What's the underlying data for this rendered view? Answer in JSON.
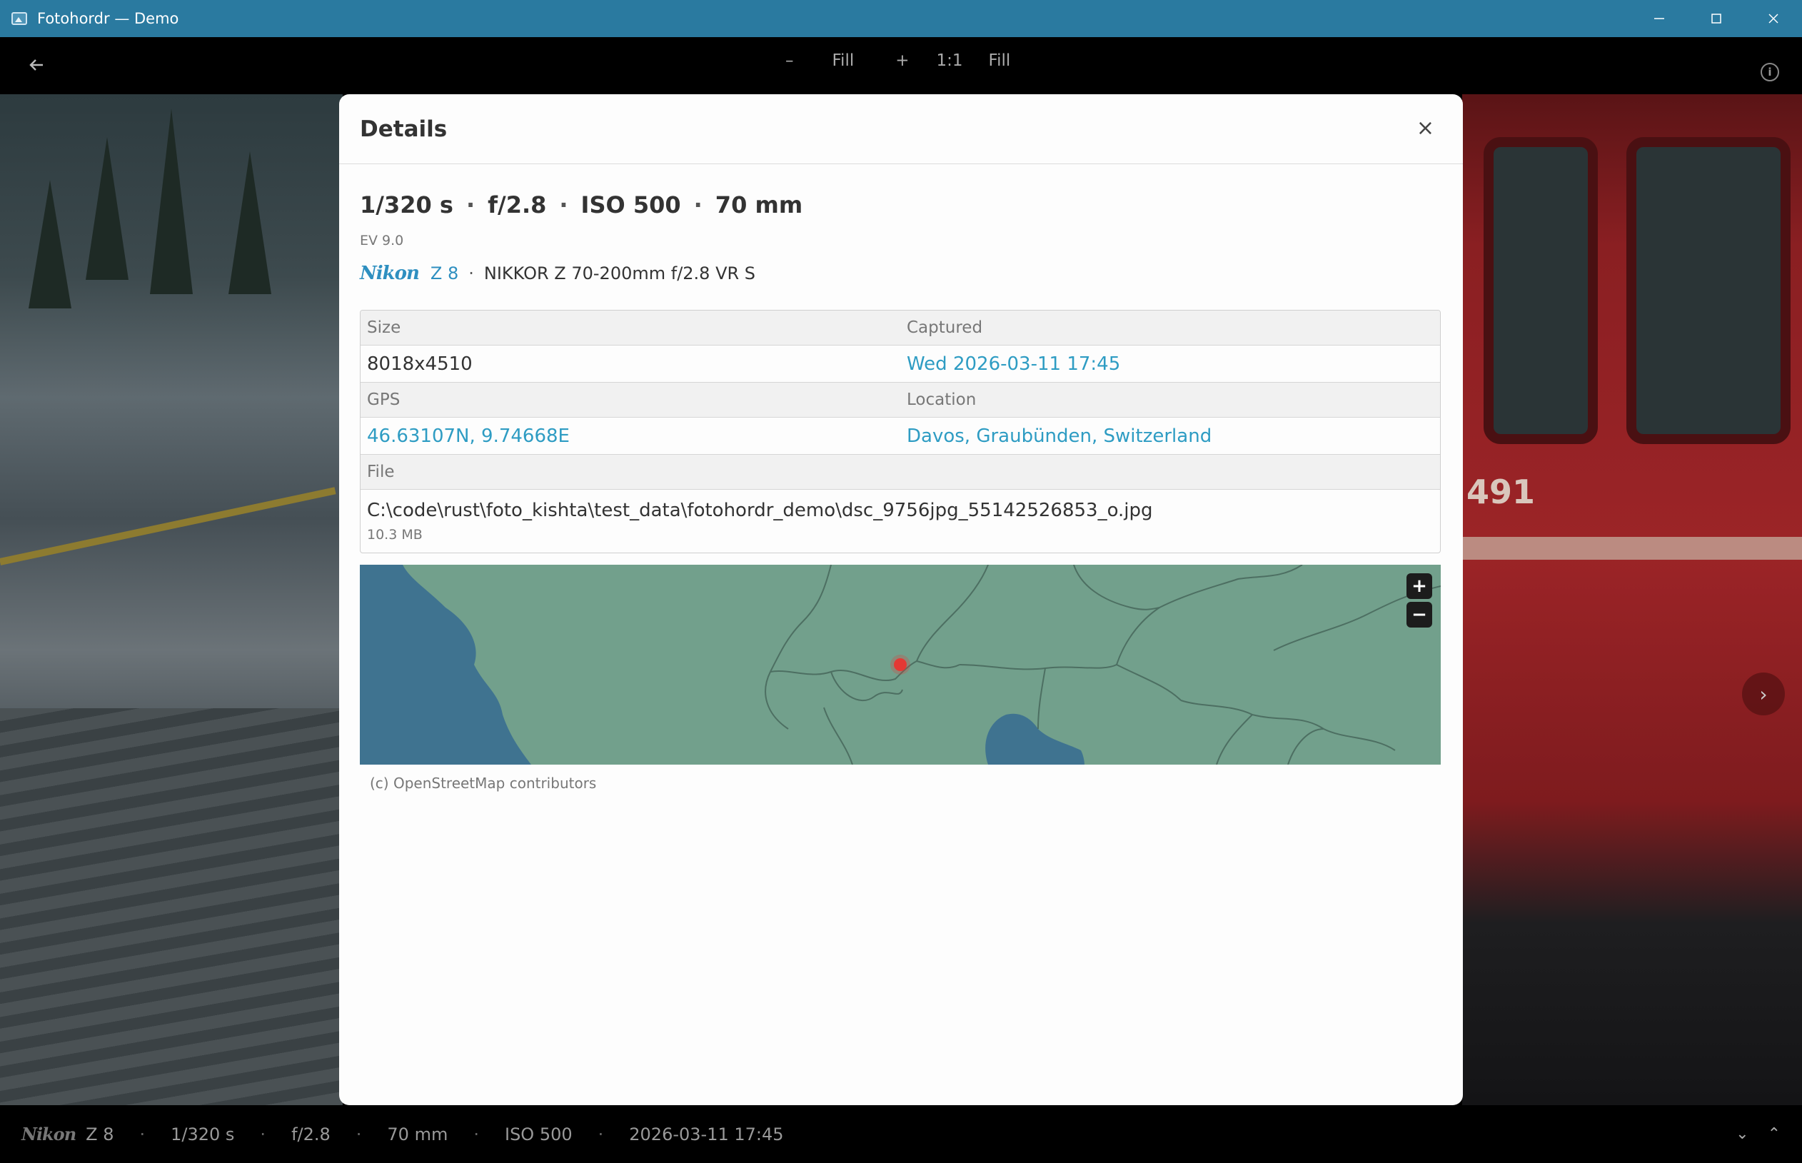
{
  "window": {
    "title": "Fotohordr — Demo",
    "minimize_glyph": "—",
    "maximize_glyph": "☐",
    "close_glyph": "✕"
  },
  "toolbar": {
    "back_glyph": "←",
    "zoom_out": "–",
    "fill_left": "Fill",
    "zoom_in": "+",
    "one_to_one": "1:1",
    "fill_right": "Fill",
    "info_glyph": "i"
  },
  "photo": {
    "train_number": "491",
    "next_glyph": "›"
  },
  "dialog": {
    "title": "Details",
    "close_glyph": "×",
    "exposure": {
      "shutter": "1/320 s",
      "aperture": "f/2.8",
      "iso": "ISO 500",
      "focal_length": "70 mm",
      "separator": "·"
    },
    "ev": "EV 9.0",
    "camera": {
      "brand": "Nikon",
      "model": "Z 8",
      "separator": "·",
      "lens": "NIKKOR Z 70-200mm f/2.8 VR S"
    },
    "table": {
      "size_label": "Size",
      "size_value": "8018x4510",
      "captured_label": "Captured",
      "captured_value": "Wed 2026-03-11 17:45",
      "gps_label": "GPS",
      "gps_value": "46.63107N, 9.74668E",
      "location_label": "Location",
      "location_value": "Davos, Graubünden, Switzerland",
      "file_label": "File",
      "file_path": "C:\\code\\rust\\foto_kishta\\test_data\\fotohordr_demo\\dsc_9756jpg_55142526853_o.jpg",
      "file_size": "10.3 MB"
    },
    "map": {
      "zoom_in": "+",
      "zoom_out": "−",
      "attribution": "(c) OpenStreetMap contributors",
      "land_color": "#72a08c",
      "water_color": "#3f7390",
      "marker_color": "#e53935"
    }
  },
  "bottombar": {
    "brand": "Nikon",
    "model": "Z 8",
    "shutter": "1/320 s",
    "aperture": "f/2.8",
    "focal_length": "70 mm",
    "iso": "ISO 500",
    "datetime": "2026-03-11 17:45",
    "separator": "·",
    "down_glyph": "⌄",
    "up_glyph": "⌃"
  }
}
